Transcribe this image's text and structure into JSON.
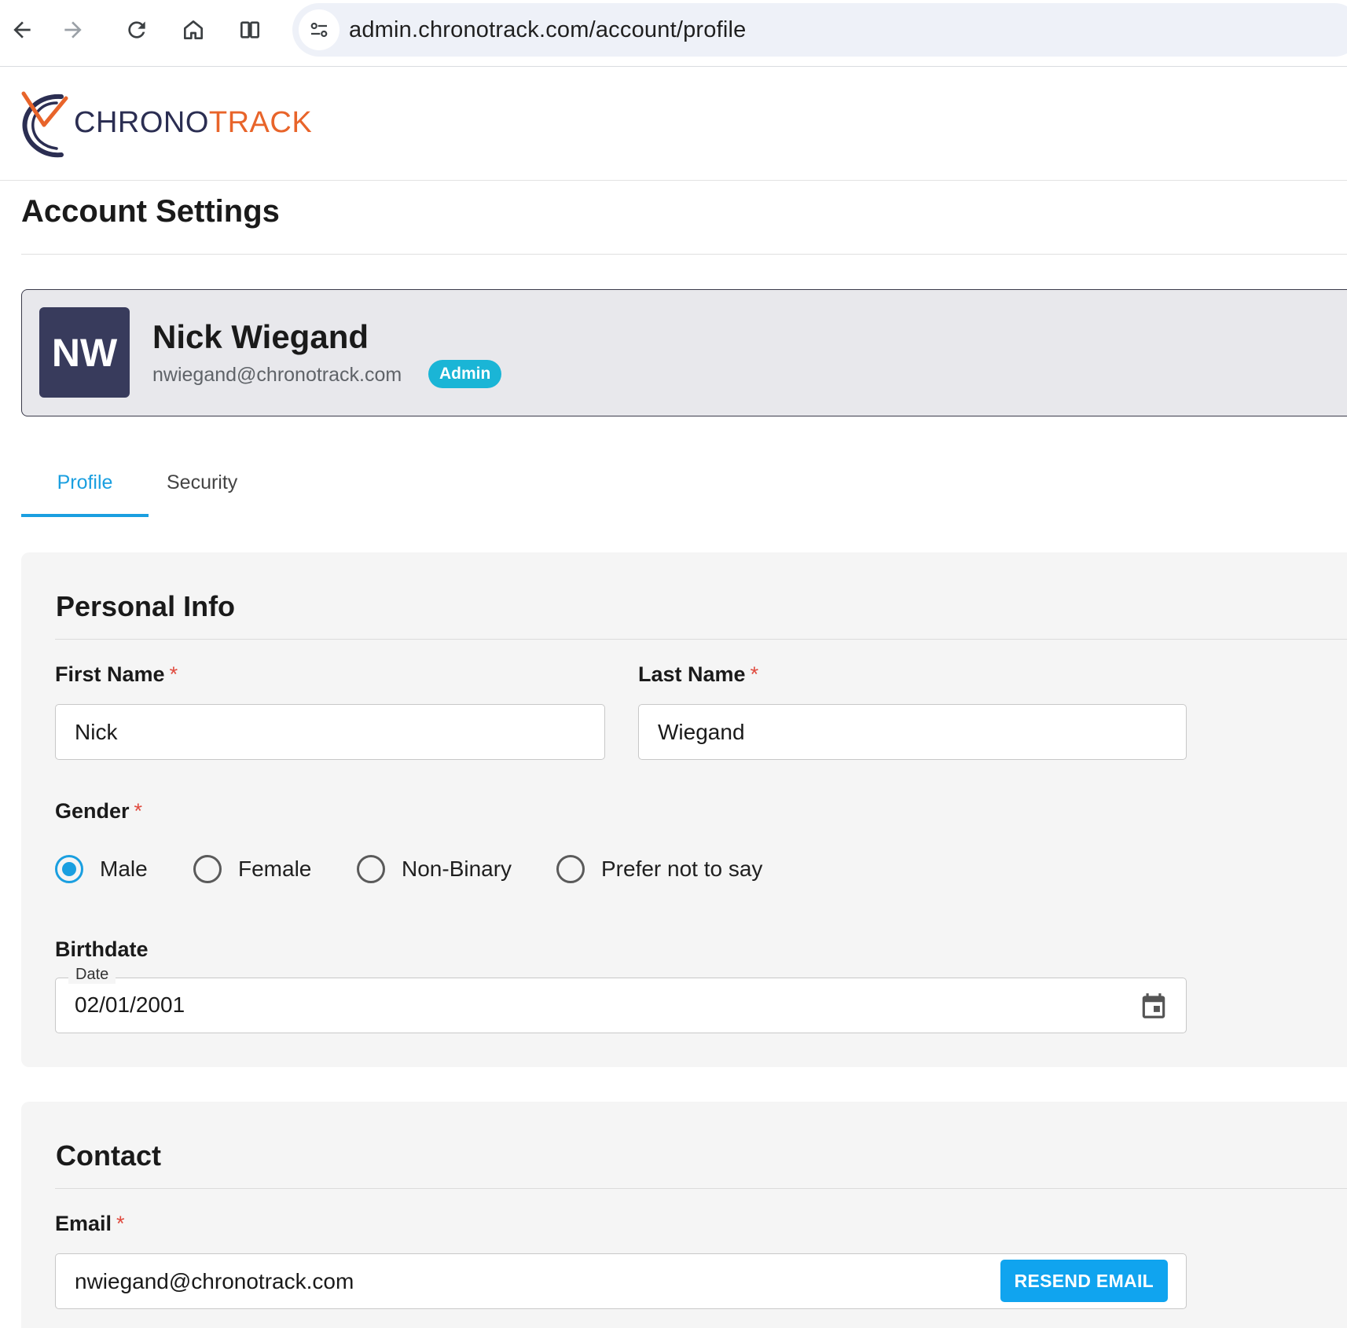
{
  "browser": {
    "url": "admin.chronotrack.com/account/profile",
    "icons": [
      "back-arrow-icon",
      "forward-arrow-icon",
      "reload-icon",
      "home-icon",
      "split-view-icon",
      "site-info-icon"
    ]
  },
  "brand": {
    "logo_part1": "CHRONO",
    "logo_part2": "TRACK",
    "primary_color": "#2b2e52",
    "accent_color": "#e8642a"
  },
  "page": {
    "title": "Account Settings"
  },
  "profile": {
    "initials": "NW",
    "name": "Nick Wiegand",
    "email": "nwiegand@chronotrack.com",
    "role": "Admin",
    "badge_color": "#1ab5d6"
  },
  "tabs": [
    {
      "label": "Profile",
      "active": true
    },
    {
      "label": "Security",
      "active": false
    }
  ],
  "personal_info": {
    "title": "Personal Info",
    "first_name_label": "First Name",
    "first_name_value": "Nick",
    "last_name_label": "Last Name",
    "last_name_value": "Wiegand",
    "required_marker": "*",
    "gender_label": "Gender",
    "gender_options": [
      "Male",
      "Female",
      "Non-Binary",
      "Prefer not to say"
    ],
    "gender_selected": "Male",
    "birthdate_label": "Birthdate",
    "date_legend": "Date",
    "birthdate_value": "02/01/2001"
  },
  "contact": {
    "title": "Contact",
    "email_label": "Email",
    "email_value": "nwiegand@chronotrack.com",
    "resend_label": "RESEND EMAIL"
  },
  "colors": {
    "accent_blue": "#1a9fe0",
    "required_red": "#e04b3f"
  }
}
